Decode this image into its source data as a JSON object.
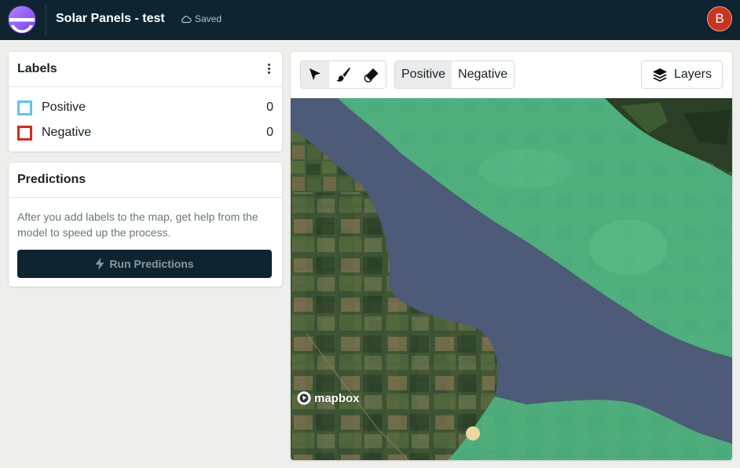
{
  "header": {
    "project_title": "Solar Panels - test",
    "save_status": "Saved",
    "avatar_initial": "B",
    "logo_icon": "app-logo-icon"
  },
  "labels_panel": {
    "title": "Labels",
    "menu_icon": "kebab-menu-icon",
    "items": [
      {
        "name": "Positive",
        "count": "0",
        "color": "#5bc4ee"
      },
      {
        "name": "Negative",
        "count": "0",
        "color": "#d6291b"
      }
    ]
  },
  "predictions_panel": {
    "title": "Predictions",
    "description": "After you add labels to the map, get help from the model to speed up the process.",
    "run_button": "Run Predictions",
    "run_icon": "lightning-icon"
  },
  "map_toolbar": {
    "tools": [
      "pointer-icon",
      "brush-icon",
      "eraser-icon"
    ],
    "active_tool": "pointer-icon",
    "class_options": [
      "Positive",
      "Negative"
    ],
    "active_class": "Positive",
    "layers_button": "Layers"
  },
  "map": {
    "attribution": "mapbox"
  },
  "colors": {
    "topbar": "#0e2430",
    "avatar": "#c9341f",
    "prediction_overlay": "#4fb583",
    "water": "#4d5a78"
  }
}
